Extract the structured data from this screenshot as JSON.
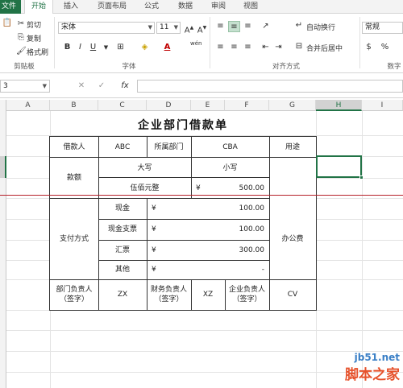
{
  "ribbon_tabs": [
    "文件",
    "开始",
    "插入",
    "页面布局",
    "公式",
    "数据",
    "审阅",
    "视图"
  ],
  "clipboard": {
    "cut": "剪切",
    "copy": "复制",
    "format_painter": "格式刷",
    "group_label": "剪贴板"
  },
  "font": {
    "name": "宋体",
    "size": "11",
    "bold": "B",
    "italic": "I",
    "underline": "U",
    "group_label": "字体",
    "wen": "wén"
  },
  "alignment": {
    "wrap_text": "自动换行",
    "merge_center": "合并后居中",
    "group_label": "对齐方式"
  },
  "number": {
    "format": "常规",
    "group_label": "数字"
  },
  "formula_bar": {
    "name_box": "3",
    "fx": "fx"
  },
  "columns": [
    "A",
    "B",
    "C",
    "D",
    "E",
    "F",
    "G",
    "H",
    "I"
  ],
  "selected_column": "H",
  "sheet": {
    "title": "企业部门借款单",
    "borrower_label": "借款人",
    "borrower_value": "ABC",
    "dept_label": "所属部门",
    "dept_value": "CBA",
    "purpose_label": "用途",
    "amount_label": "款额",
    "amount_upper_label": "大写",
    "amount_lower_label": "小写",
    "amount_upper_value": "伍佰元整",
    "amount_lower_currency": "¥",
    "amount_lower_value": "500.00",
    "payment_label": "支付方式",
    "purpose_value": "办公费",
    "payments": [
      {
        "method": "现金",
        "currency": "¥",
        "amount": "100.00"
      },
      {
        "method": "现金支票",
        "currency": "¥",
        "amount": "100.00"
      },
      {
        "method": "汇票",
        "currency": "¥",
        "amount": "300.00"
      },
      {
        "method": "其他",
        "currency": "¥",
        "amount": "-"
      }
    ],
    "dept_head_label": "部门负责人（签字）",
    "dept_head_value": "ZX",
    "finance_head_label": "财务负责人（签字）",
    "finance_head_value": "XZ",
    "company_head_label": "企业负责人（签字）",
    "company_head_value": "CV"
  },
  "watermark": {
    "site": "jb51.net",
    "name": "脚本之家"
  }
}
